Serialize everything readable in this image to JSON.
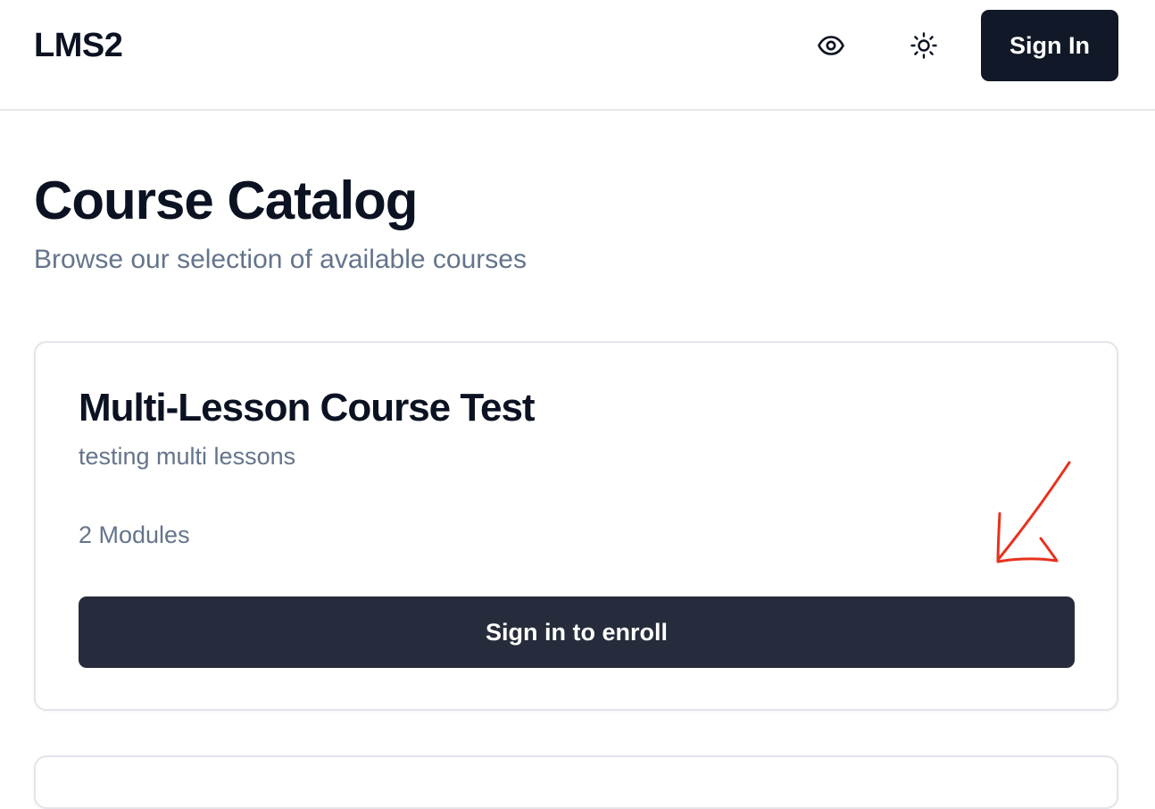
{
  "header": {
    "brand": "LMS2",
    "icons": [
      "eye-icon",
      "sun-icon"
    ],
    "sign_in_label": "Sign In"
  },
  "main": {
    "title": "Course Catalog",
    "subtitle": "Browse our selection of available courses",
    "courses": [
      {
        "title": "Multi-Lesson Course Test",
        "description": "testing multi lessons",
        "modules": "2 Modules",
        "enroll_label": "Sign in to enroll"
      }
    ]
  },
  "colors": {
    "primary_button": "#111827",
    "enroll_button": "#262c3b",
    "muted_text": "#64748b",
    "annotation": "#e8321e"
  }
}
